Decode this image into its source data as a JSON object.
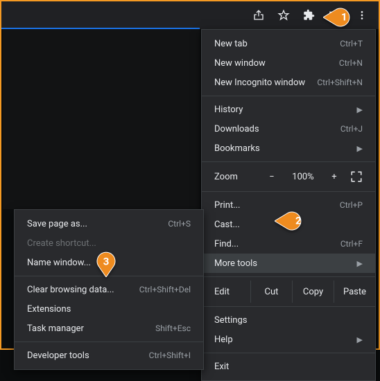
{
  "toolbar": {
    "icons": [
      "share-icon",
      "star-icon",
      "extensions-icon",
      "reading-list-icon",
      "menu-dots-icon"
    ]
  },
  "menu": {
    "new_tab": {
      "label": "New tab",
      "shortcut": "Ctrl+T"
    },
    "new_window": {
      "label": "New window",
      "shortcut": "Ctrl+N"
    },
    "new_incognito": {
      "label": "New Incognito window",
      "shortcut": "Ctrl+Shift+N"
    },
    "history": {
      "label": "History"
    },
    "downloads": {
      "label": "Downloads",
      "shortcut": "Ctrl+J"
    },
    "bookmarks": {
      "label": "Bookmarks"
    },
    "zoom": {
      "label": "Zoom",
      "minus": "−",
      "pct": "100%",
      "plus": "+"
    },
    "print": {
      "label": "Print...",
      "shortcut": "Ctrl+P"
    },
    "cast": {
      "label": "Cast..."
    },
    "find": {
      "label": "Find...",
      "shortcut": "Ctrl+F"
    },
    "more_tools": {
      "label": "More tools"
    },
    "edit_row": {
      "label": "Edit",
      "cut": "Cut",
      "copy": "Copy",
      "paste": "Paste"
    },
    "settings": {
      "label": "Settings"
    },
    "help": {
      "label": "Help"
    },
    "exit": {
      "label": "Exit"
    }
  },
  "submenu": {
    "save_page": {
      "label": "Save page as...",
      "shortcut": "Ctrl+S"
    },
    "create_shortcut": {
      "label": "Create shortcut..."
    },
    "name_window": {
      "label": "Name window..."
    },
    "clear_data": {
      "label": "Clear browsing data...",
      "shortcut": "Ctrl+Shift+Del"
    },
    "extensions": {
      "label": "Extensions"
    },
    "task_manager": {
      "label": "Task manager",
      "shortcut": "Shift+Esc"
    },
    "dev_tools": {
      "label": "Developer tools",
      "shortcut": "Ctrl+Shift+I"
    }
  },
  "callouts": {
    "one": "1",
    "two": "2",
    "three": "3"
  },
  "colors": {
    "accent": "#f59a23"
  }
}
